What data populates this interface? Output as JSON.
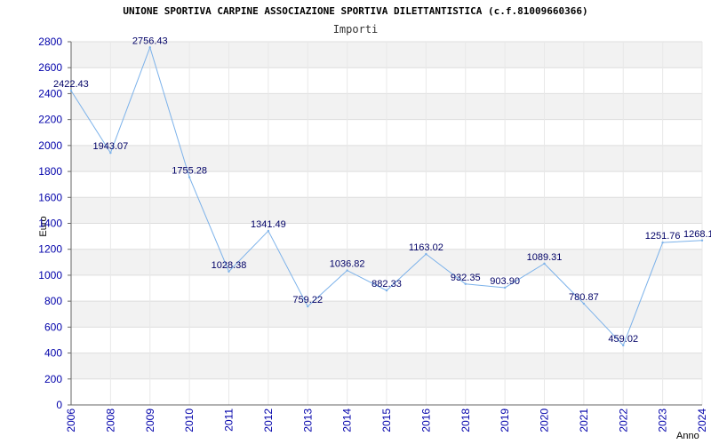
{
  "chart_data": {
    "type": "line",
    "title": "UNIONE SPORTIVA CARPINE ASSOCIAZIONE SPORTIVA DILETTANTISTICA (c.f.81009660366)",
    "subtitle": "Importi",
    "xlabel": "Anno",
    "ylabel": "Euro",
    "ylim": [
      0,
      2800
    ],
    "yticks": [
      "0",
      "200",
      "400",
      "600",
      "800",
      "1000",
      "1200",
      "1400",
      "1600",
      "1800",
      "2000",
      "2200",
      "2400",
      "2600",
      "2800"
    ],
    "grid": true,
    "categories": [
      "2006",
      "2008",
      "2009",
      "2010",
      "2011",
      "2012",
      "2013",
      "2014",
      "2015",
      "2016",
      "2018",
      "2019",
      "2020",
      "2021",
      "2022",
      "2023",
      "2024"
    ],
    "series": [
      {
        "values": [
          2422.43,
          1943.07,
          2756.43,
          1755.28,
          1028.38,
          1341.49,
          759.22,
          1036.82,
          882.33,
          1163.02,
          932.35,
          903.9,
          1089.31,
          780.87,
          459.02,
          1251.76,
          1268.1
        ],
        "labels": [
          "2422.43",
          "1943.07",
          "2756.43",
          "1755.28",
          "1028.38",
          "1341.49",
          "759.22",
          "1036.82",
          "882.33",
          "1163.02",
          "932.35",
          "903.90",
          "1089.31",
          "780.87",
          "459.02",
          "1251.76",
          "1268.1"
        ]
      }
    ],
    "colors": {
      "line": "#7cb2ea",
      "band": "#f2f2f2",
      "grid": "#dddddd",
      "axis": "#666666",
      "tick_text": "#0000aa",
      "label_text": "#000066"
    }
  }
}
